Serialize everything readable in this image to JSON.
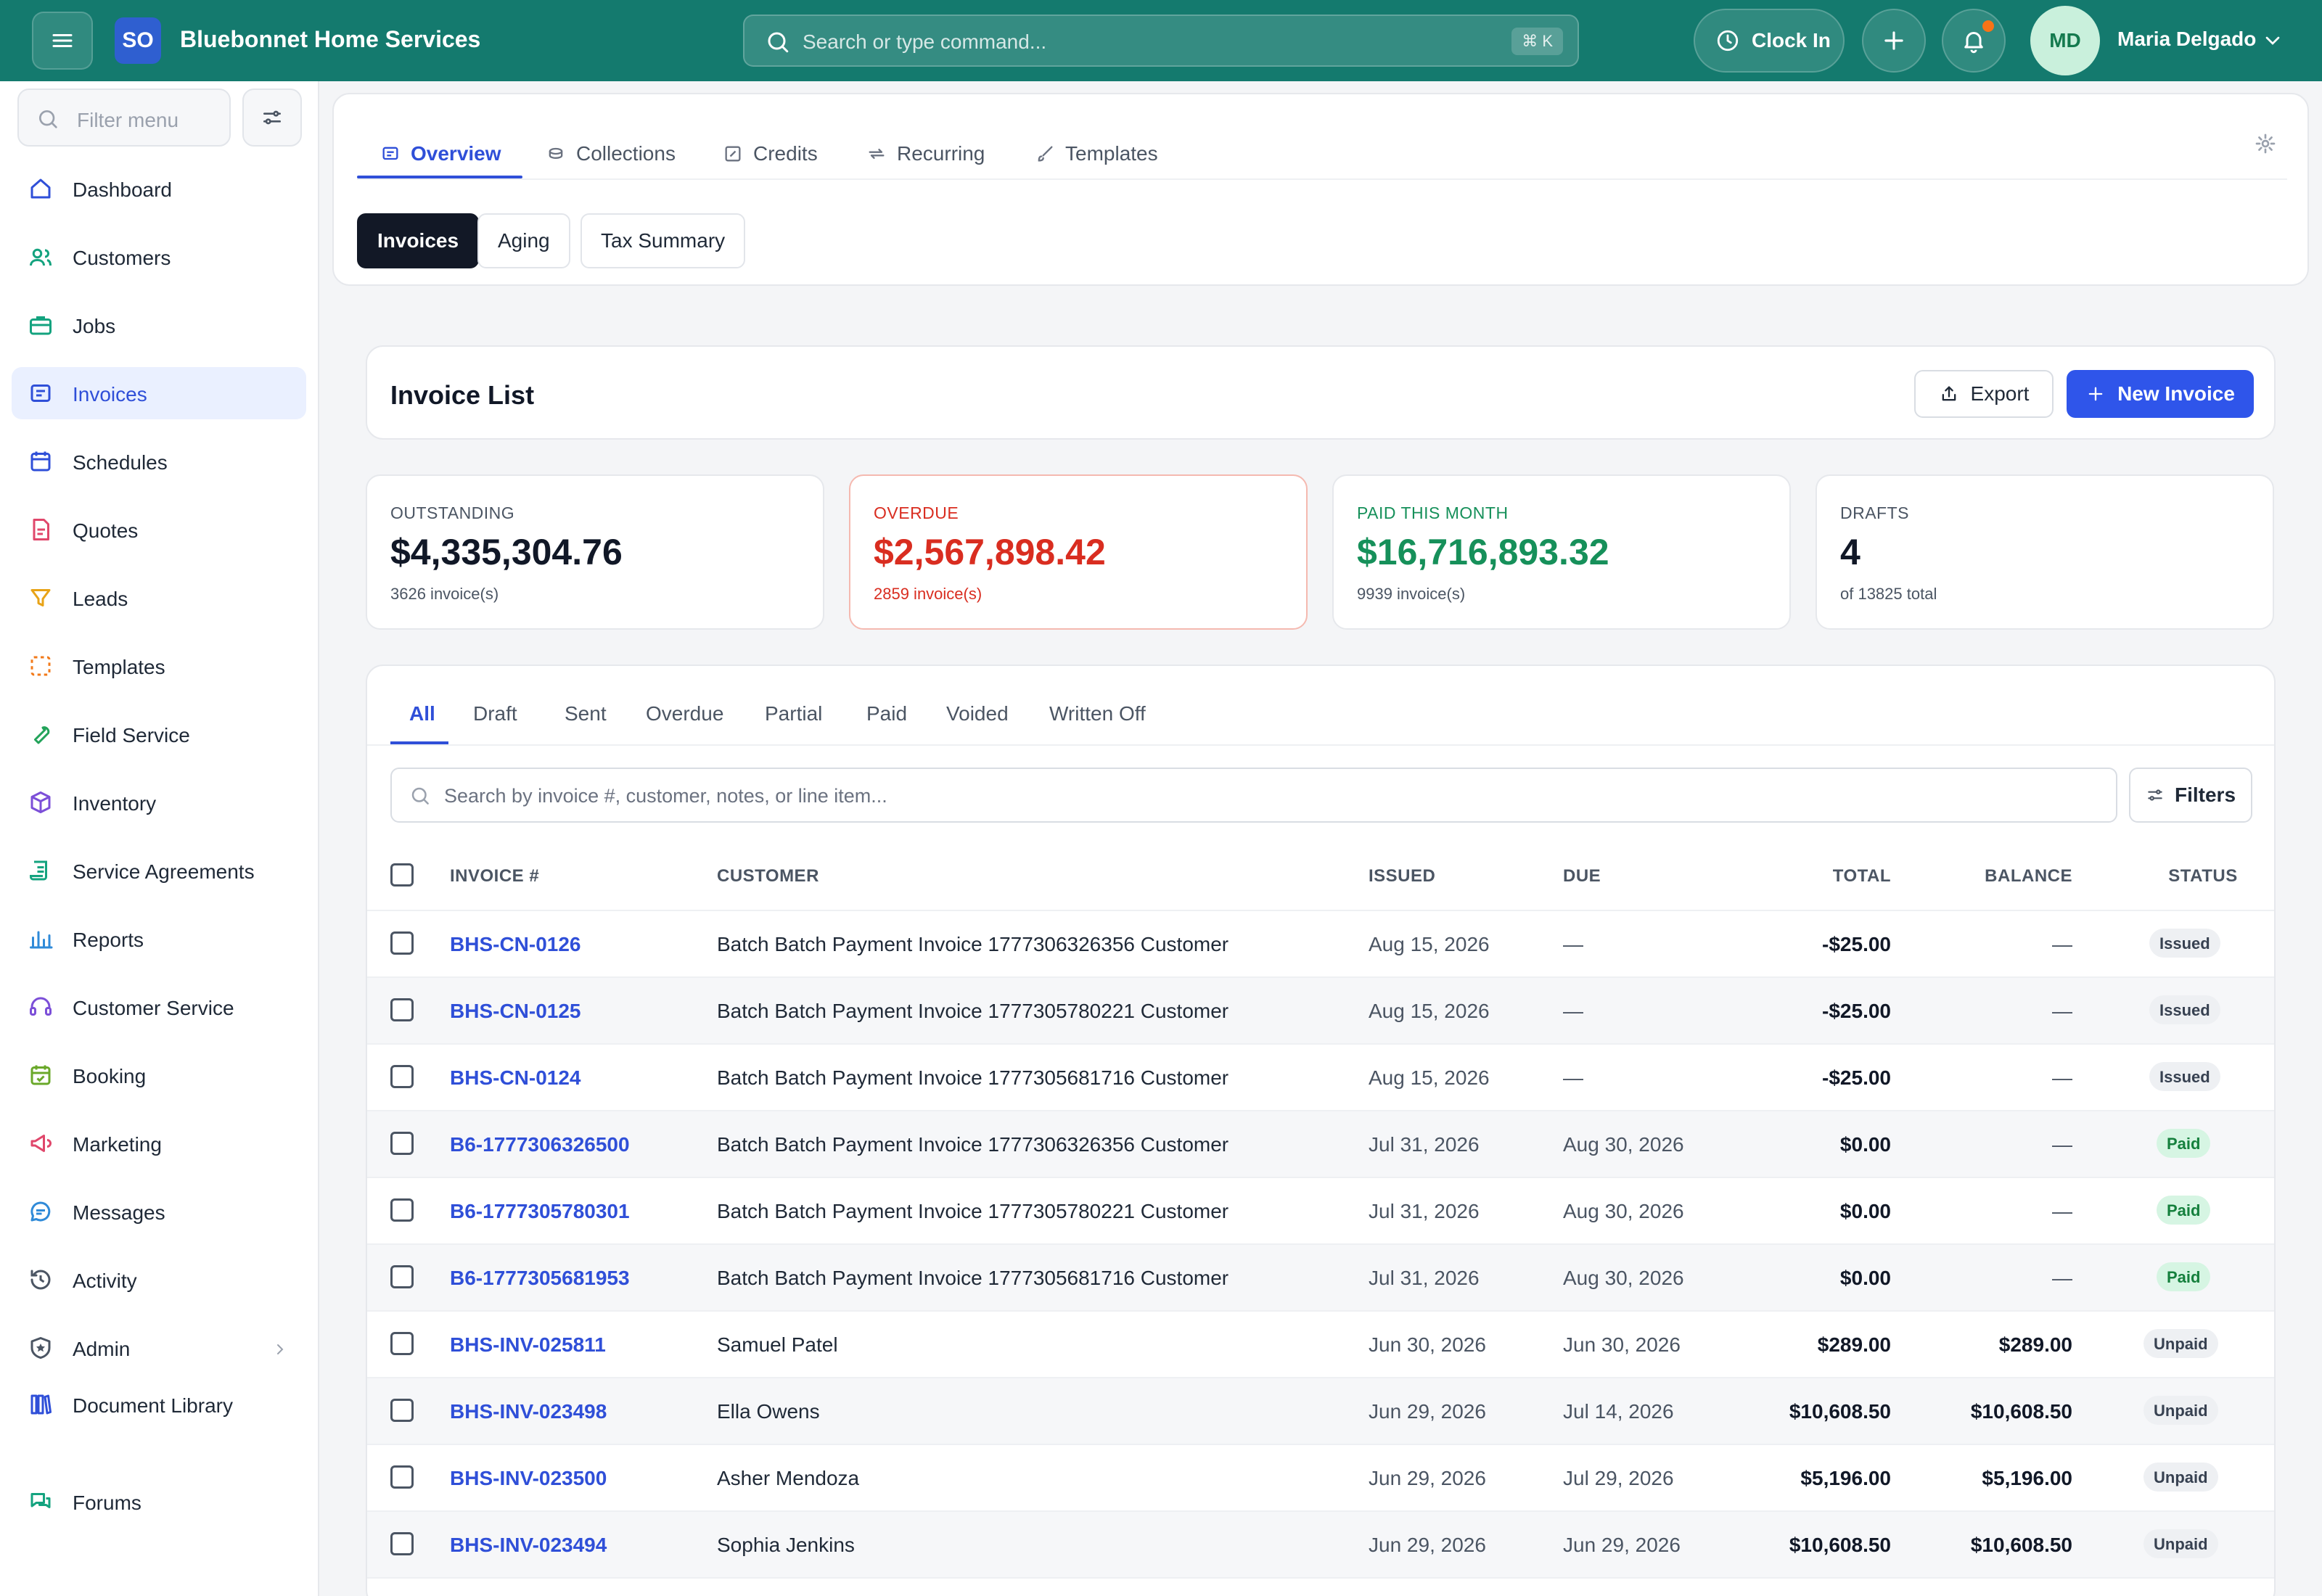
{
  "app": {
    "logo_text": "SO",
    "brand": "Bluebonnet Home Services",
    "search_placeholder": "Search or type command...",
    "search_shortcut": "⌘ K",
    "clock_in": "Clock In",
    "user_initials": "MD",
    "user_name": "Maria Delgado"
  },
  "sidebar": {
    "filter_placeholder": "Filter menu",
    "items": [
      {
        "label": "Dashboard",
        "icon": "home-icon"
      },
      {
        "label": "Customers",
        "icon": "users-icon"
      },
      {
        "label": "Jobs",
        "icon": "briefcase-icon"
      },
      {
        "label": "Invoices",
        "icon": "invoice-icon",
        "active": true
      },
      {
        "label": "Schedules",
        "icon": "calendar-icon"
      },
      {
        "label": "Quotes",
        "icon": "document-icon"
      },
      {
        "label": "Leads",
        "icon": "funnel-icon"
      },
      {
        "label": "Templates",
        "icon": "template-icon"
      },
      {
        "label": "Field Service",
        "icon": "wrench-icon"
      },
      {
        "label": "Inventory",
        "icon": "box-icon"
      },
      {
        "label": "Service Agreements",
        "icon": "scroll-icon"
      },
      {
        "label": "Reports",
        "icon": "bar-chart-icon"
      },
      {
        "label": "Customer Service",
        "icon": "headset-icon"
      },
      {
        "label": "Booking",
        "icon": "calendar-check-icon"
      },
      {
        "label": "Marketing",
        "icon": "megaphone-icon"
      },
      {
        "label": "Messages",
        "icon": "chat-icon"
      },
      {
        "label": "Activity",
        "icon": "history-icon"
      },
      {
        "label": "Admin",
        "icon": "shield-star-icon"
      },
      {
        "label": "Document Library",
        "icon": "books-icon"
      },
      {
        "label": "Forums",
        "icon": "forum-icon"
      }
    ]
  },
  "tabs": {
    "main": [
      "Overview",
      "Collections",
      "Credits",
      "Recurring",
      "Templates"
    ],
    "sub": [
      "Invoices",
      "Aging",
      "Tax Summary"
    ]
  },
  "invoice_list": {
    "title": "Invoice List",
    "export": "Export",
    "new_invoice": "New Invoice"
  },
  "stats": [
    {
      "label": "OUTSTANDING",
      "value": "$4,335,304.76",
      "sub": "3626 invoice(s)",
      "color": "#111827"
    },
    {
      "label": "OVERDUE",
      "value": "$2,567,898.42",
      "sub": "2859 invoice(s)",
      "color": "#d92d20"
    },
    {
      "label": "PAID THIS MONTH",
      "value": "$16,716,893.32",
      "sub": "9939 invoice(s)",
      "color": "#16905a"
    },
    {
      "label": "DRAFTS",
      "value": "4",
      "sub": "of 13825 total",
      "color": "#111827"
    }
  ],
  "status_tabs": [
    "All",
    "Draft",
    "Sent",
    "Overdue",
    "Partial",
    "Paid",
    "Voided",
    "Written Off"
  ],
  "table": {
    "search_placeholder": "Search by invoice #, customer, notes, or line item...",
    "filters": "Filters",
    "headers": [
      "INVOICE #",
      "CUSTOMER",
      "ISSUED",
      "DUE",
      "TOTAL",
      "BALANCE",
      "STATUS"
    ],
    "rows": [
      {
        "invoice": "BHS-CN-0126",
        "customer": "Batch Batch Payment Invoice 1777306326356 Customer",
        "issued": "Aug 15, 2026",
        "due": "—",
        "total": "-$25.00",
        "balance": "—",
        "status": "Issued"
      },
      {
        "invoice": "BHS-CN-0125",
        "customer": "Batch Batch Payment Invoice 1777305780221 Customer",
        "issued": "Aug 15, 2026",
        "due": "—",
        "total": "-$25.00",
        "balance": "—",
        "status": "Issued"
      },
      {
        "invoice": "BHS-CN-0124",
        "customer": "Batch Batch Payment Invoice 1777305681716 Customer",
        "issued": "Aug 15, 2026",
        "due": "—",
        "total": "-$25.00",
        "balance": "—",
        "status": "Issued"
      },
      {
        "invoice": "B6-1777306326500",
        "customer": "Batch Batch Payment Invoice 1777306326356 Customer",
        "issued": "Jul 31, 2026",
        "due": "Aug 30, 2026",
        "total": "$0.00",
        "balance": "—",
        "status": "Paid"
      },
      {
        "invoice": "B6-1777305780301",
        "customer": "Batch Batch Payment Invoice 1777305780221 Customer",
        "issued": "Jul 31, 2026",
        "due": "Aug 30, 2026",
        "total": "$0.00",
        "balance": "—",
        "status": "Paid"
      },
      {
        "invoice": "B6-1777305681953",
        "customer": "Batch Batch Payment Invoice 1777305681716 Customer",
        "issued": "Jul 31, 2026",
        "due": "Aug 30, 2026",
        "total": "$0.00",
        "balance": "—",
        "status": "Paid"
      },
      {
        "invoice": "BHS-INV-025811",
        "customer": "Samuel Patel",
        "issued": "Jun 30, 2026",
        "due": "Jun 30, 2026",
        "total": "$289.00",
        "balance": "$289.00",
        "status": "Unpaid"
      },
      {
        "invoice": "BHS-INV-023498",
        "customer": "Ella Owens",
        "issued": "Jun 29, 2026",
        "due": "Jul 14, 2026",
        "total": "$10,608.50",
        "balance": "$10,608.50",
        "status": "Unpaid"
      },
      {
        "invoice": "BHS-INV-023500",
        "customer": "Asher Mendoza",
        "issued": "Jun 29, 2026",
        "due": "Jul 29, 2026",
        "total": "$5,196.00",
        "balance": "$5,196.00",
        "status": "Unpaid"
      },
      {
        "invoice": "BHS-INV-023494",
        "customer": "Sophia Jenkins",
        "issued": "Jun 29, 2026",
        "due": "Jun 29, 2026",
        "total": "$10,608.50",
        "balance": "$10,608.50",
        "status": "Unpaid"
      }
    ]
  }
}
